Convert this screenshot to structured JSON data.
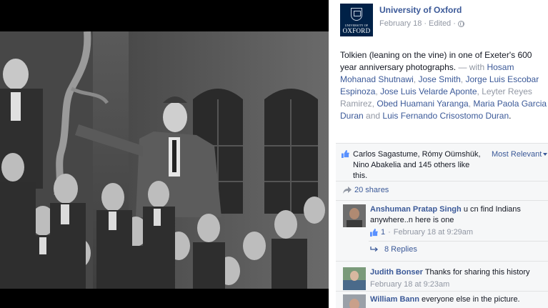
{
  "post": {
    "page_name": "University of Oxford",
    "logo_line1": "UNIVERSITY OF",
    "logo_line2": "OXFORD",
    "date": "February 18",
    "edited": "Edited",
    "caption_text": "Tolkien (leaning on the vine) in one of Exeter's 600 year anniversary photographs.",
    "with_prefix": "— with",
    "tags": [
      "Hosam Mohanad Shutnawi",
      "Jose Smith",
      "Jorge Luis Escobar Espinoza",
      "Jose Luis Velarde Aponte",
      "Leyter Reyes Ramirez",
      "Obed Huamani Yaranga",
      "Maria Paola Garcia Duran",
      "Luis Fernando Crisostomo Duran"
    ],
    "and_word": "and"
  },
  "likes": {
    "summary": "Carlos Sagastume, Rómy Oümshük, Nino Abakelia and 145 others like this.",
    "sort_label": "Most Relevant",
    "shares": "20 shares"
  },
  "comments": [
    {
      "name": "Anshuman Pratap Singh",
      "text": "u cn find Indians anywhere..n here is one",
      "likes": "1",
      "date": "February 18 at 9:29am",
      "replies": "8 Replies"
    },
    {
      "name": "Judith Bonser",
      "text": "Thanks for sharing this history",
      "date": "February 18 at 9:23am"
    },
    {
      "name": "William Bann",
      "text": "everyone else in the picture."
    }
  ],
  "colors": {
    "link": "#3b5998",
    "muted": "#9197a3",
    "logo_bg": "#002147"
  },
  "icons": [
    "like-thumb-icon",
    "share-arrow-icon",
    "reply-arrow-icon",
    "globe-icon"
  ]
}
